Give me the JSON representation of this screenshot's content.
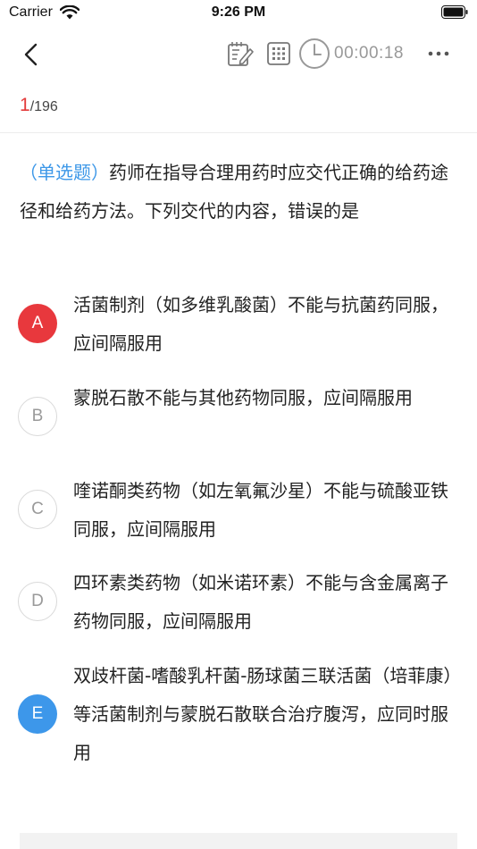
{
  "status_bar": {
    "carrier": "Carrier",
    "time": "9:26 PM"
  },
  "nav": {
    "timer": "00:00:18",
    "icons": {
      "back": "chevron-left-icon",
      "edit": "edit-note-icon",
      "grid": "answer-sheet-grid-icon",
      "clock": "clock-icon",
      "more": "more-dots-icon"
    }
  },
  "progress": {
    "current": "1",
    "total": "/196"
  },
  "question": {
    "type_label": "（单选题）",
    "text": "药师在指导合理用药时应交代正确的给药途径和给药方法。下列交代的内容，错误的是"
  },
  "options": [
    {
      "letter": "A",
      "text": "活菌制剂（如多维乳酸菌）不能与抗菌药同服，应间隔服用",
      "state": "wrong"
    },
    {
      "letter": "B",
      "text": "蒙脱石散不能与其他药物同服，应间隔服用",
      "state": "none"
    },
    {
      "letter": "C",
      "text": "喹诺酮类药物（如左氧氟沙星）不能与硫酸亚铁同服，应间隔服用",
      "state": "none"
    },
    {
      "letter": "D",
      "text": "四环素类药物（如米诺环素）不能与含金属离子药物同服，应间隔服用",
      "state": "none"
    },
    {
      "letter": "E",
      "text": "双歧杆菌-嗜酸乳杆菌-肠球菌三联活菌（培菲康）等活菌制剂与蒙脱石散联合治疗腹泻，应同时服用",
      "state": "correct"
    }
  ],
  "colors": {
    "accent_blue": "#3d97ea",
    "wrong_red": "#e8383d",
    "progress_red": "#e33b3b",
    "question_type_blue": "#3e98e8",
    "timer_gray": "#999999"
  }
}
